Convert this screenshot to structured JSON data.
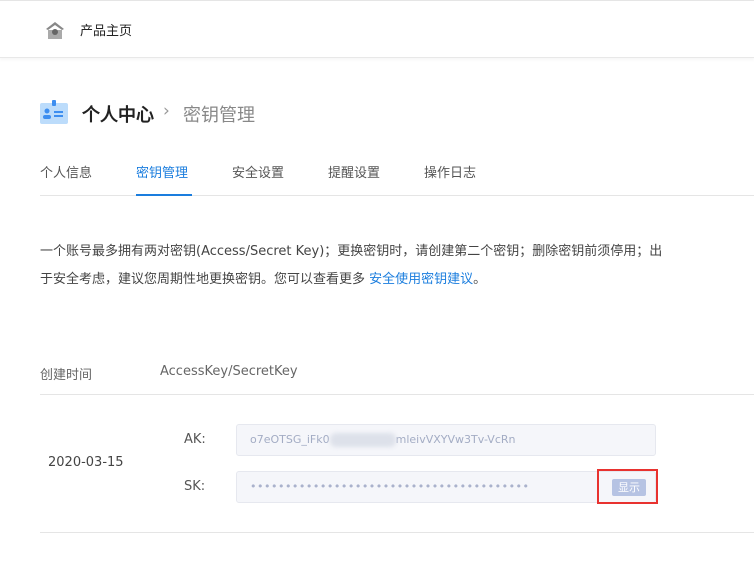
{
  "topbar": {
    "home_label": "产品主页"
  },
  "header": {
    "title": "个人中心",
    "separator": "›",
    "current": "密钥管理"
  },
  "tabs": [
    {
      "label": "个人信息"
    },
    {
      "label": "密钥管理",
      "active": true
    },
    {
      "label": "安全设置"
    },
    {
      "label": "提醒设置"
    },
    {
      "label": "操作日志"
    }
  ],
  "description": {
    "text": "一个账号最多拥有两对密钥(Access/Secret Key)；更换密钥时，请创建第二个密钥；删除密钥前须停用；出于安全考虑，建议您周期性地更换密钥。您可以查看更多 ",
    "link": "安全使用密钥建议",
    "suffix": "。"
  },
  "table": {
    "headers": [
      "创建时间",
      "AccessKey/SecretKey"
    ],
    "rows": [
      {
        "created": "2020-03-15",
        "ak_label": "AK:",
        "ak_prefix": "o7eOTSG_iFk0",
        "ak_suffix": "mleivVXYVw3Tv-VcRn",
        "sk_label": "SK:",
        "sk_value": "••••••••••••••••••••••••••••••••••••••••",
        "show_label": "显示"
      }
    ]
  },
  "colors": {
    "accent": "#1a7dde",
    "highlight": "#e8322f"
  }
}
